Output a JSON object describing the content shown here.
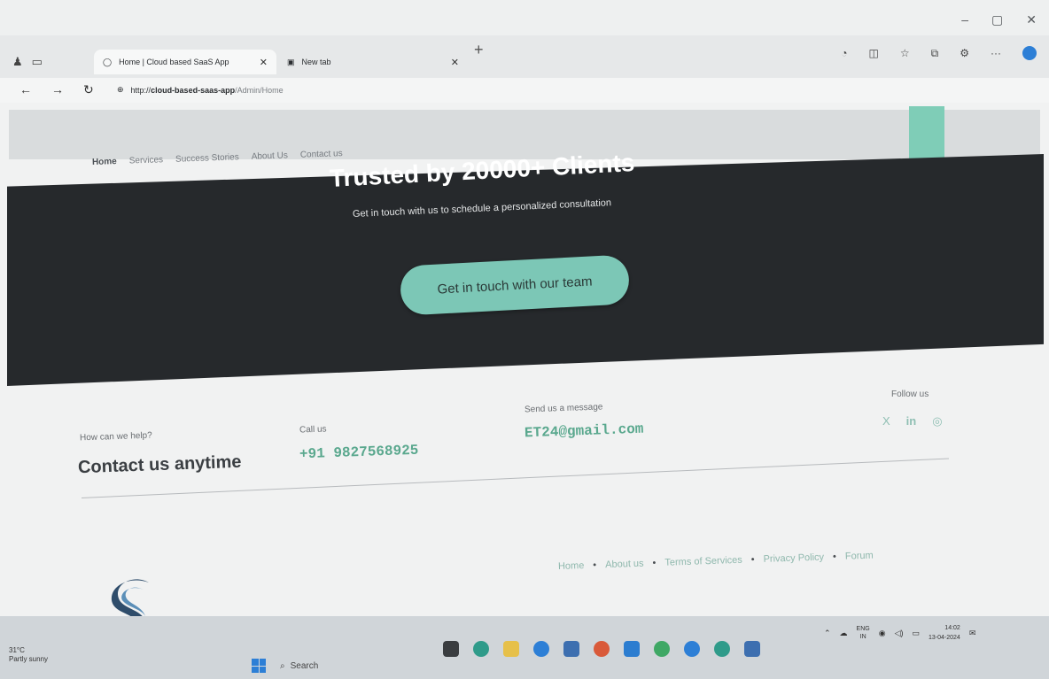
{
  "browser": {
    "tabs": [
      {
        "title": "Home | Cloud based SaaS App",
        "active": true
      },
      {
        "title": "New tab",
        "active": false
      }
    ],
    "address": {
      "prefix": "http://",
      "host": "cloud-based-saas-app",
      "path": "/Admin/Home"
    }
  },
  "site": {
    "nav": [
      "Home",
      "Services",
      "Success Stories",
      "About Us",
      "Contact us"
    ],
    "hero": {
      "title": "Trusted by 20000+ Clients",
      "subtitle": "Get in touch with us to schedule a personalized consultation",
      "button": "Get in touch with our team"
    },
    "contact": {
      "help_question": "How can we help?",
      "help_heading": "Contact us anytime",
      "call_label": "Call us",
      "call_value": "+91 9827568925",
      "message_label": "Send us a message",
      "message_value": "ET24@gmail.com",
      "follow_label": "Follow us"
    },
    "footer_links": [
      "Home",
      "About us",
      "Terms of Services",
      "Privacy Policy",
      "Forum"
    ]
  },
  "taskbar": {
    "weather": {
      "temp": "31°C",
      "desc": "Partly sunny"
    },
    "search_placeholder": "Search",
    "language": "ENG",
    "region": "IN",
    "time": "14:02",
    "date": "13-04-2024"
  },
  "colors": {
    "accent": "#7cc7b6",
    "hero_bg": "#26292c",
    "contact_value": "#5aa88e"
  }
}
